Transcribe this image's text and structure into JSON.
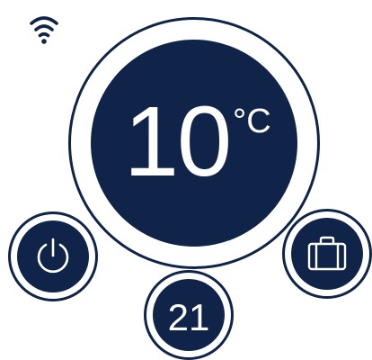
{
  "status": {
    "wifi_icon": "wifi-icon"
  },
  "dial": {
    "temperature": "10",
    "unit": "°C"
  },
  "buttons": {
    "power_icon": "power-icon",
    "away_icon": "briefcase-icon",
    "setpoint": "21"
  },
  "colors": {
    "primary": "#0f2448",
    "background": "#ffffff",
    "text": "#ffffff"
  }
}
